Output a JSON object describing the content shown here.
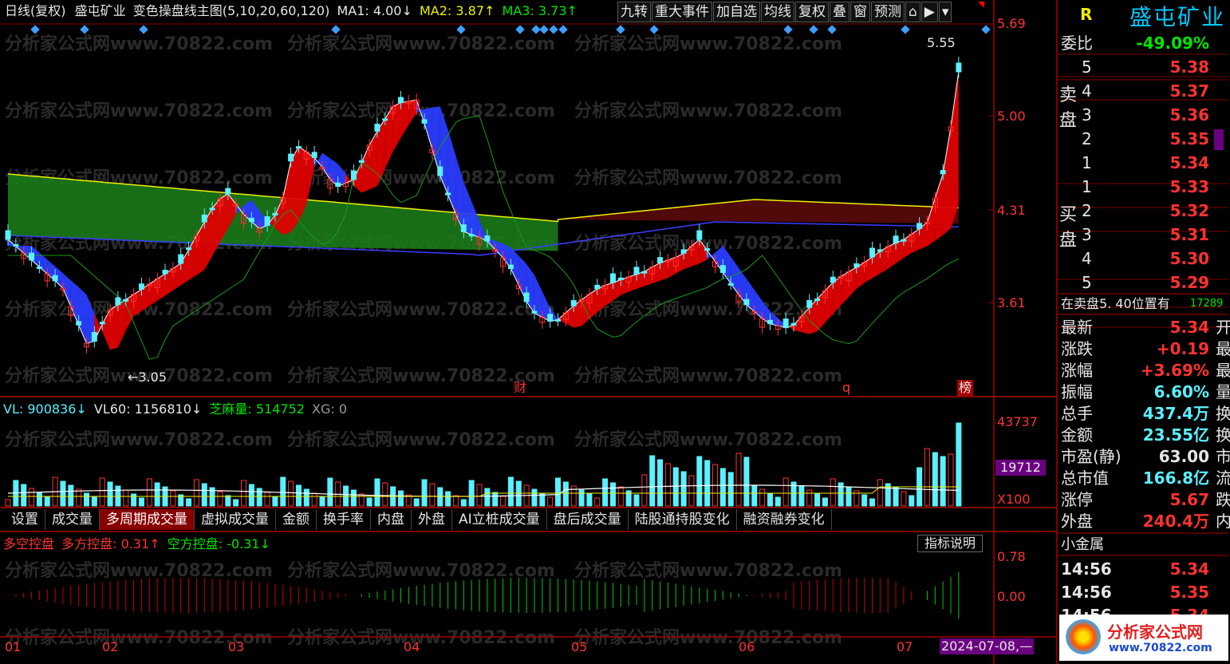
{
  "title_bar": {
    "period": "日线(复权)",
    "stock": "盛屯矿业",
    "indicator": "变色操盘线主图(5,10,20,60,120)",
    "ma1": "MA1: 4.00↓",
    "ma2": "MA2: 3.87↑",
    "ma3": "MA3: 3.73↑"
  },
  "toolbar": [
    "九转",
    "重大事件",
    "加自选",
    "均线",
    "复权",
    "叠",
    "窗",
    "预测"
  ],
  "price_axis": [
    "5.69",
    "5.00",
    "4.31",
    "3.61"
  ],
  "annotations": {
    "high": "5.55",
    "low": "←3.05",
    "mark_cai": "财",
    "mark_q": "q",
    "mark_bang": "榜"
  },
  "volume": {
    "vl": "VL: 900836↓",
    "vl60": "VL60: 1156810↓",
    "zhima": "芝麻量: 514752",
    "xg": "XG: 0",
    "axis_top": "43737",
    "axis_mid": "19712",
    "axis_unit": "X100"
  },
  "tabs": [
    "设置",
    "成交量",
    "多周期成交量",
    "虚拟成交量",
    "金额",
    "换手率",
    "内盘",
    "外盘",
    "AI立桩成交量",
    "盘后成交量",
    "陆股通持股变化",
    "融资融券变化"
  ],
  "oscillator": {
    "name": "多空控盘",
    "bull": "多方控盘: 0.31↑",
    "bear": "空方控盘: -0.31↓",
    "help": "指标说明",
    "axis_top": "0.78",
    "axis_mid": "0.00"
  },
  "date_axis": [
    "01",
    "02",
    "03",
    "04",
    "05",
    "06",
    "07"
  ],
  "cursor_date": "2024-07-08,—",
  "side_panel": {
    "r_label": "R",
    "name": "盛屯矿业",
    "weibi_label": "委比",
    "weibi": "-49.09%",
    "sell_label": "卖\n盘",
    "buy_label": "买\n盘",
    "sell": [
      {
        "n": "5",
        "p": "5.38"
      },
      {
        "n": "4",
        "p": "5.37"
      },
      {
        "n": "3",
        "p": "5.36"
      },
      {
        "n": "2",
        "p": "5.35"
      },
      {
        "n": "1",
        "p": "5.34"
      }
    ],
    "buy": [
      {
        "n": "1",
        "p": "5.33"
      },
      {
        "n": "2",
        "p": "5.32"
      },
      {
        "n": "3",
        "p": "5.31"
      },
      {
        "n": "4",
        "p": "5.30"
      },
      {
        "n": "5",
        "p": "5.29"
      }
    ],
    "notice": "在卖盘5. 40位置有",
    "notice_val": "17289",
    "stats": [
      {
        "k": "最新",
        "v": "5.34",
        "c": "#ff3232",
        "s": "开"
      },
      {
        "k": "涨跌",
        "v": "+0.19",
        "c": "#ff3232",
        "s": "最"
      },
      {
        "k": "涨幅",
        "v": "+3.69%",
        "c": "#ff3232",
        "s": "最"
      },
      {
        "k": "振幅",
        "v": "6.60%",
        "c": "#5af0ff",
        "s": "量"
      },
      {
        "k": "总手",
        "v": "437.4万",
        "c": "#5af0ff",
        "s": "换"
      },
      {
        "k": "金额",
        "v": "23.55亿",
        "c": "#5af0ff",
        "s": "换"
      },
      {
        "k": "市盈(静)",
        "v": "63.00",
        "c": "#e6e6e6",
        "s": "市"
      },
      {
        "k": "总市值",
        "v": "166.8亿",
        "c": "#5af0ff",
        "s": "流"
      },
      {
        "k": "涨停",
        "v": "5.67",
        "c": "#ff3232",
        "s": "跌"
      },
      {
        "k": "外盘",
        "v": "240.4万",
        "c": "#ff3232",
        "s": "内"
      }
    ],
    "sector": "小金属",
    "ticks": [
      {
        "t": "14:56",
        "p": "5.34"
      },
      {
        "t": "14:56",
        "p": "5.35"
      },
      {
        "t": "14:56",
        "p": "5.34"
      }
    ],
    "logo_cn": "分析家公式网",
    "logo_url": "www.70822.com"
  },
  "watermark": "分析家公式网www.70822.com",
  "colors": {
    "up": "#ff3232",
    "down": "#5af0ff",
    "ma_yellow": "#f0f000",
    "ma_blue": "#3c3cff",
    "band_green": "#1a7a1a",
    "band_red": "#5a0a0a"
  }
}
